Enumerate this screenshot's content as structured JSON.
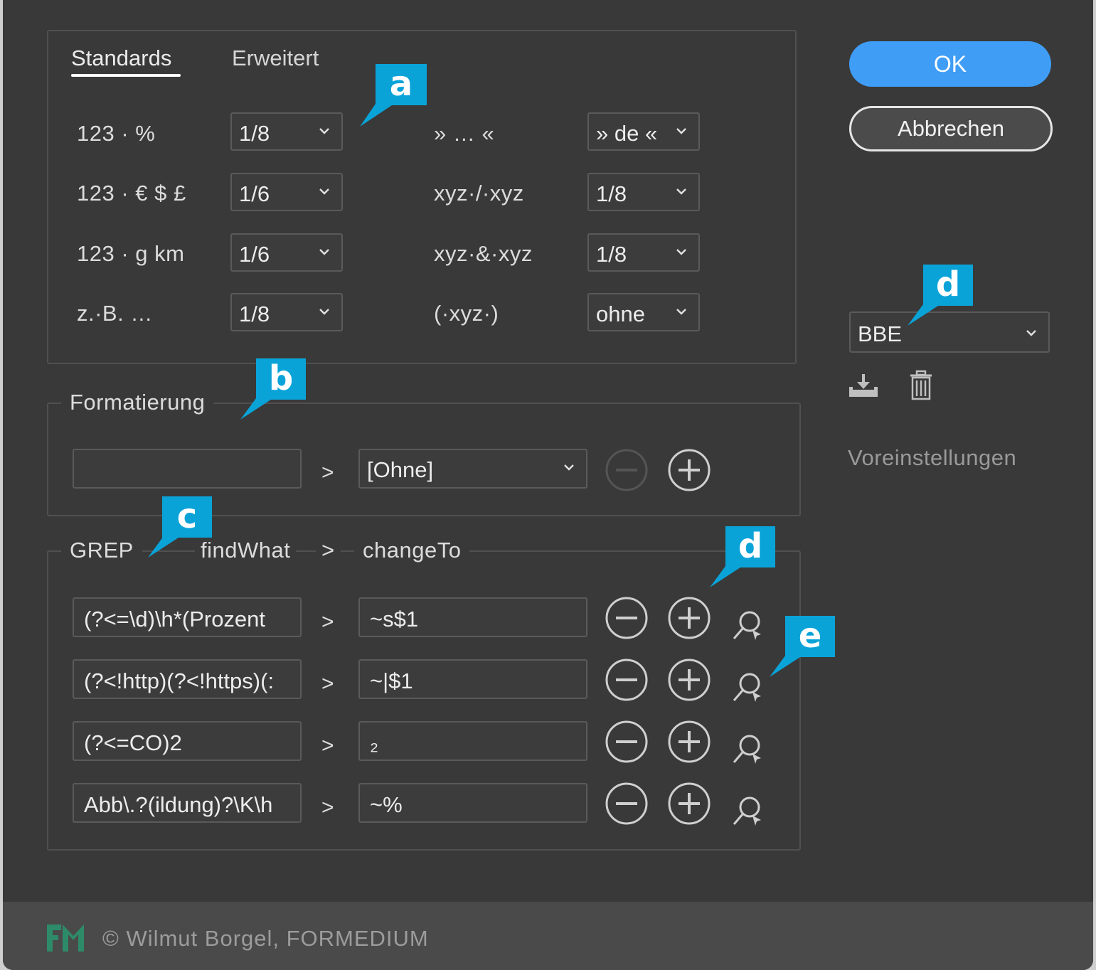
{
  "tabs": [
    {
      "label": "Standards",
      "active": true
    },
    {
      "label": "Erweitert",
      "active": false
    }
  ],
  "standards": {
    "rows_left": [
      {
        "label": "123 · %",
        "value": "1/8"
      },
      {
        "label": "123 · € $ £",
        "value": "1/6"
      },
      {
        "label": "123 · g km",
        "value": "1/6"
      },
      {
        "label": "z.·B. …",
        "value": "1/8"
      }
    ],
    "rows_right": [
      {
        "label": "» … «",
        "value": "» de «"
      },
      {
        "label": "xyz·/·xyz",
        "value": "1/8"
      },
      {
        "label": "xyz·&·xyz",
        "value": "1/8"
      },
      {
        "label": "(·xyz·)",
        "value": "ohne"
      }
    ]
  },
  "formatierung": {
    "title": "Formatierung",
    "input_value": "",
    "separator": ">",
    "style_value": "[Ohne]"
  },
  "grep": {
    "title": "GREP",
    "col_find": "findWhat",
    "col_sep": ">",
    "col_change": "changeTo",
    "rows": [
      {
        "find": "(?<=\\d)\\h*(Prozent",
        "sep": ">",
        "change": "~s$1"
      },
      {
        "find": "(?<!http)(?<!https)(:",
        "sep": ">",
        "change": "~|$1"
      },
      {
        "find": "(?<=CO)2",
        "sep": ">",
        "change": "₂"
      },
      {
        "find": "Abb\\.?(ildung)?\\K\\h",
        "sep": ">",
        "change": "~%"
      }
    ]
  },
  "buttons": {
    "ok": "OK",
    "cancel": "Abbrechen"
  },
  "presets": {
    "value": "BBE",
    "label": "Voreinstellungen",
    "save_icon": "save-preset-icon",
    "delete_icon": "trash-icon"
  },
  "badges": {
    "a": "a",
    "b": "b",
    "c": "c",
    "d_top": "d",
    "d_grep": "d",
    "e": "e"
  },
  "footer": {
    "copyright": "© Wilmut Borgel, FORMEDIUM"
  },
  "colors": {
    "accent": "#3f9df5",
    "badge": "#0aa3d8",
    "dialog_bg": "#393939",
    "logo_green": "#2e8b6a"
  }
}
